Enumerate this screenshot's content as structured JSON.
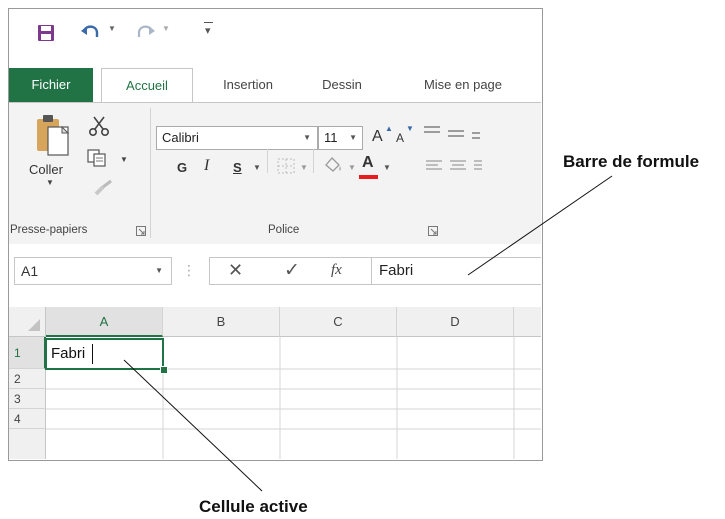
{
  "quick_access": {
    "save_icon": "save-icon",
    "undo_icon": "undo-icon",
    "redo_icon": "redo-icon",
    "customize_icon": "customize-toolbar-icon"
  },
  "tabs": [
    {
      "label": "Fichier"
    },
    {
      "label": "Accueil"
    },
    {
      "label": "Insertion"
    },
    {
      "label": "Dessin"
    },
    {
      "label": "Mise en page"
    }
  ],
  "clipboard": {
    "paste_label": "Coller",
    "group_label": "Presse-papiers"
  },
  "font": {
    "name": "Calibri",
    "size": "11",
    "bold_label": "G",
    "italic_label": "I",
    "underline_label": "S",
    "font_color_label": "A",
    "grow_label": "A",
    "shrink_label": "A",
    "group_label": "Police",
    "font_color": "#e81c1c"
  },
  "formula_bar": {
    "name_box": "A1",
    "separator": "⋮",
    "cancel": "✕",
    "enter": "✓",
    "fx": "fx",
    "value": "Fabri"
  },
  "sheet": {
    "columns": [
      "A",
      "B",
      "C",
      "D"
    ],
    "rows": [
      "1",
      "2",
      "3",
      "4"
    ],
    "cell_a1": "Fabri"
  },
  "callouts": {
    "formula_bar": "Barre de formule",
    "active_cell": "Cellule active"
  },
  "colors": {
    "accent": "#217346"
  }
}
